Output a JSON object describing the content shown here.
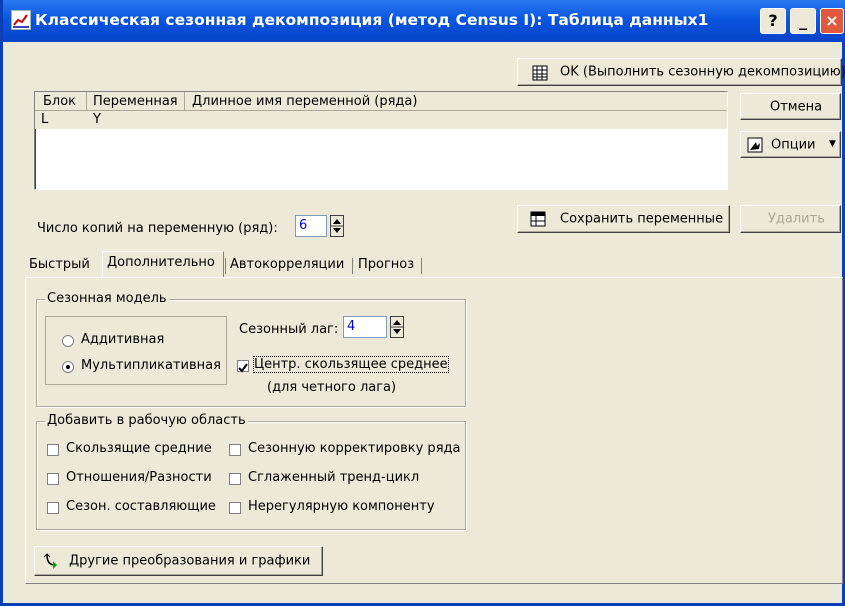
{
  "window": {
    "title": "Классическая сезонная декомпозиция (метод Census I): Таблица данных1"
  },
  "title_buttons": {
    "help": "?",
    "minimize": "_",
    "close": "×"
  },
  "buttons": {
    "ok": "OK (Выполнить сезонную декомпозицию)",
    "cancel": "Отмена",
    "options": "Опции",
    "save_vars": "Сохранить переменные",
    "delete": "Удалить",
    "other": "Другие преобразования и графики"
  },
  "var_table": {
    "headers": [
      "Блок",
      "Переменная",
      "Длинное имя переменной (ряда)"
    ],
    "rows": [
      {
        "block": "L",
        "variable": "Y",
        "long_name": ""
      }
    ]
  },
  "copies": {
    "label": "Число копий на переменную (ряд):",
    "value": "6"
  },
  "tabs": [
    "Быстрый",
    "Дополнительно",
    "Автокорреляции",
    "Прогноз"
  ],
  "seasonal_model": {
    "title": "Сезонная модель",
    "additive": "Аддитивная",
    "multiplicative": "Мультипликативная",
    "selected": "multiplicative",
    "lag_label": "Сезонный лаг:",
    "lag_value": "4",
    "center_ma_label": "Центр. скользящее среднее",
    "center_ma_note": "(для четного лага)",
    "center_ma_checked": true
  },
  "add_to_workspace": {
    "title": "Добавить в рабочую область",
    "items": [
      "Скользящие средние",
      "Сезонную корректировку ряда",
      "Отношения/Разности",
      "Сглаженный тренд-цикл",
      "Сезон. составляющие",
      "Нерегулярную компоненту"
    ]
  }
}
